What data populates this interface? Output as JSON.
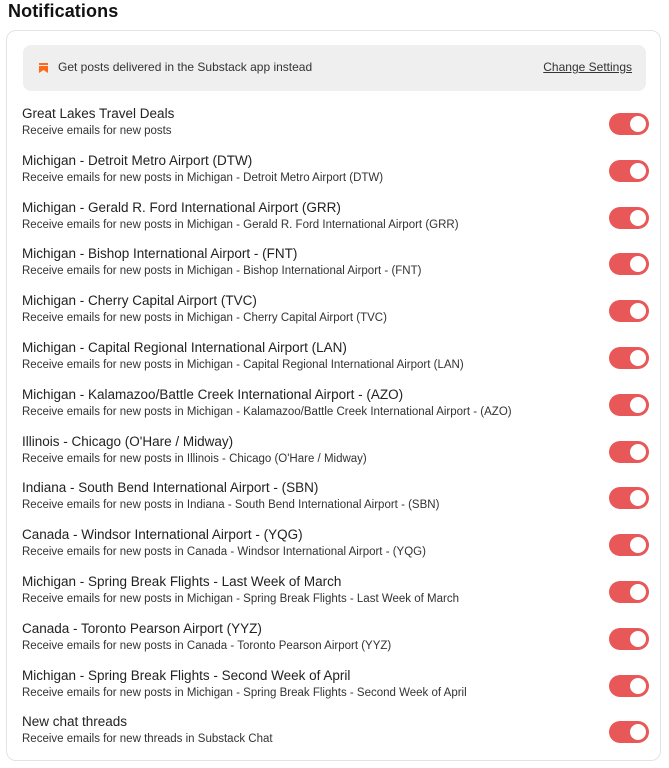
{
  "page": {
    "title": "Notifications"
  },
  "banner": {
    "icon": "bookmark-icon",
    "icon_color": "#ff6719",
    "text": "Get posts delivered in the Substack app instead",
    "link_label": "Change Settings"
  },
  "toggle_color": "#e85858",
  "items": [
    {
      "title": "Great Lakes Travel Deals",
      "subtitle": "Receive emails for new posts",
      "enabled": true
    },
    {
      "title": "Michigan - Detroit Metro Airport (DTW)",
      "subtitle": "Receive emails for new posts in Michigan - Detroit Metro Airport (DTW)",
      "enabled": true
    },
    {
      "title": "Michigan - Gerald R. Ford International Airport (GRR)",
      "subtitle": "Receive emails for new posts in Michigan - Gerald R. Ford International Airport (GRR)",
      "enabled": true
    },
    {
      "title": "Michigan - Bishop International Airport - (FNT)",
      "subtitle": "Receive emails for new posts in Michigan - Bishop International Airport - (FNT)",
      "enabled": true
    },
    {
      "title": "Michigan - Cherry Capital Airport (TVC)",
      "subtitle": "Receive emails for new posts in Michigan - Cherry Capital Airport (TVC)",
      "enabled": true
    },
    {
      "title": "Michigan - Capital Regional International Airport (LAN)",
      "subtitle": "Receive emails for new posts in Michigan - Capital Regional International Airport (LAN)",
      "enabled": true
    },
    {
      "title": "Michigan - Kalamazoo/Battle Creek International Airport - (AZO)",
      "subtitle": "Receive emails for new posts in Michigan - Kalamazoo/Battle Creek International Airport - (AZO)",
      "enabled": true
    },
    {
      "title": "Illinois - Chicago (O'Hare / Midway)",
      "subtitle": "Receive emails for new posts in Illinois - Chicago (O'Hare / Midway)",
      "enabled": true
    },
    {
      "title": "Indiana - South Bend International Airport - (SBN)",
      "subtitle": "Receive emails for new posts in Indiana - South Bend International Airport - (SBN)",
      "enabled": true
    },
    {
      "title": "Canada - Windsor International Airport - (YQG)",
      "subtitle": "Receive emails for new posts in Canada - Windsor International Airport - (YQG)",
      "enabled": true
    },
    {
      "title": "Michigan - Spring Break Flights - Last Week of March",
      "subtitle": "Receive emails for new posts in Michigan - Spring Break Flights - Last Week of March",
      "enabled": true
    },
    {
      "title": "Canada - Toronto Pearson Airport (YYZ)",
      "subtitle": "Receive emails for new posts in Canada - Toronto Pearson Airport (YYZ)",
      "enabled": true
    },
    {
      "title": "Michigan - Spring Break Flights - Second Week of April",
      "subtitle": "Receive emails for new posts in Michigan - Spring Break Flights - Second Week of April",
      "enabled": true
    },
    {
      "title": "New chat threads",
      "subtitle": "Receive emails for new threads in Substack Chat",
      "enabled": true
    }
  ]
}
